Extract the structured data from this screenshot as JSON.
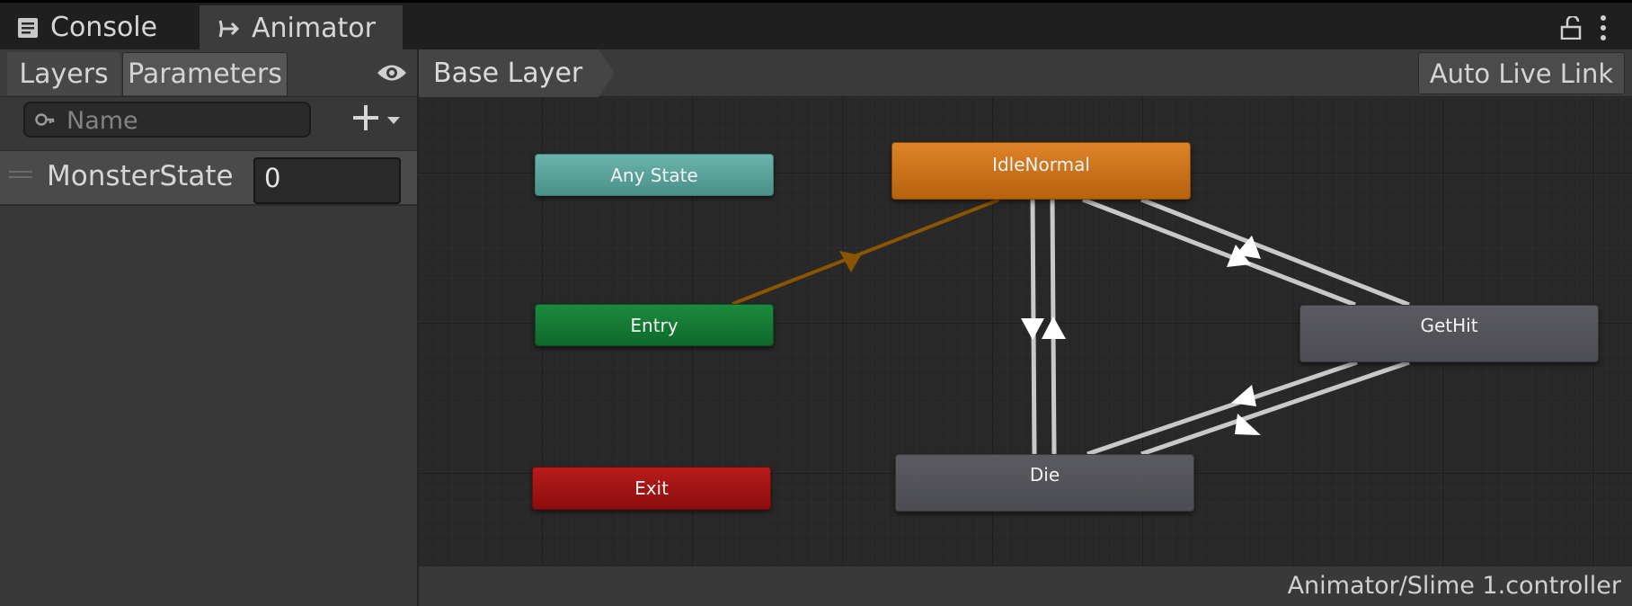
{
  "tabs": {
    "console_label": "Console",
    "animator_label": "Animator"
  },
  "left_panel": {
    "tabs": [
      "Layers",
      "Parameters"
    ],
    "search": {
      "placeholder": "Name"
    },
    "parameters": [
      {
        "name": "MonsterState",
        "value": "0"
      }
    ]
  },
  "graph": {
    "breadcrumb": "Base Layer",
    "auto_live_link_label": "Auto Live Link",
    "states": {
      "any_state": "Any State",
      "entry": "Entry",
      "exit": "Exit",
      "idle_normal": "IdleNormal",
      "get_hit": "GetHit",
      "die": "Die"
    },
    "state_colors": {
      "any_state": "#5fa8a0",
      "entry": "#14782f",
      "exit": "#a51313",
      "idle_normal": "#d0771d",
      "regular": "#545559"
    }
  },
  "status": {
    "controller_path": "Animator/Slime 1.controller"
  },
  "icons": [
    "console-icon",
    "animator-icon",
    "lock-icon",
    "more-icon",
    "eye-icon",
    "search-icon",
    "add-icon",
    "dropdown-arrow-icon"
  ]
}
